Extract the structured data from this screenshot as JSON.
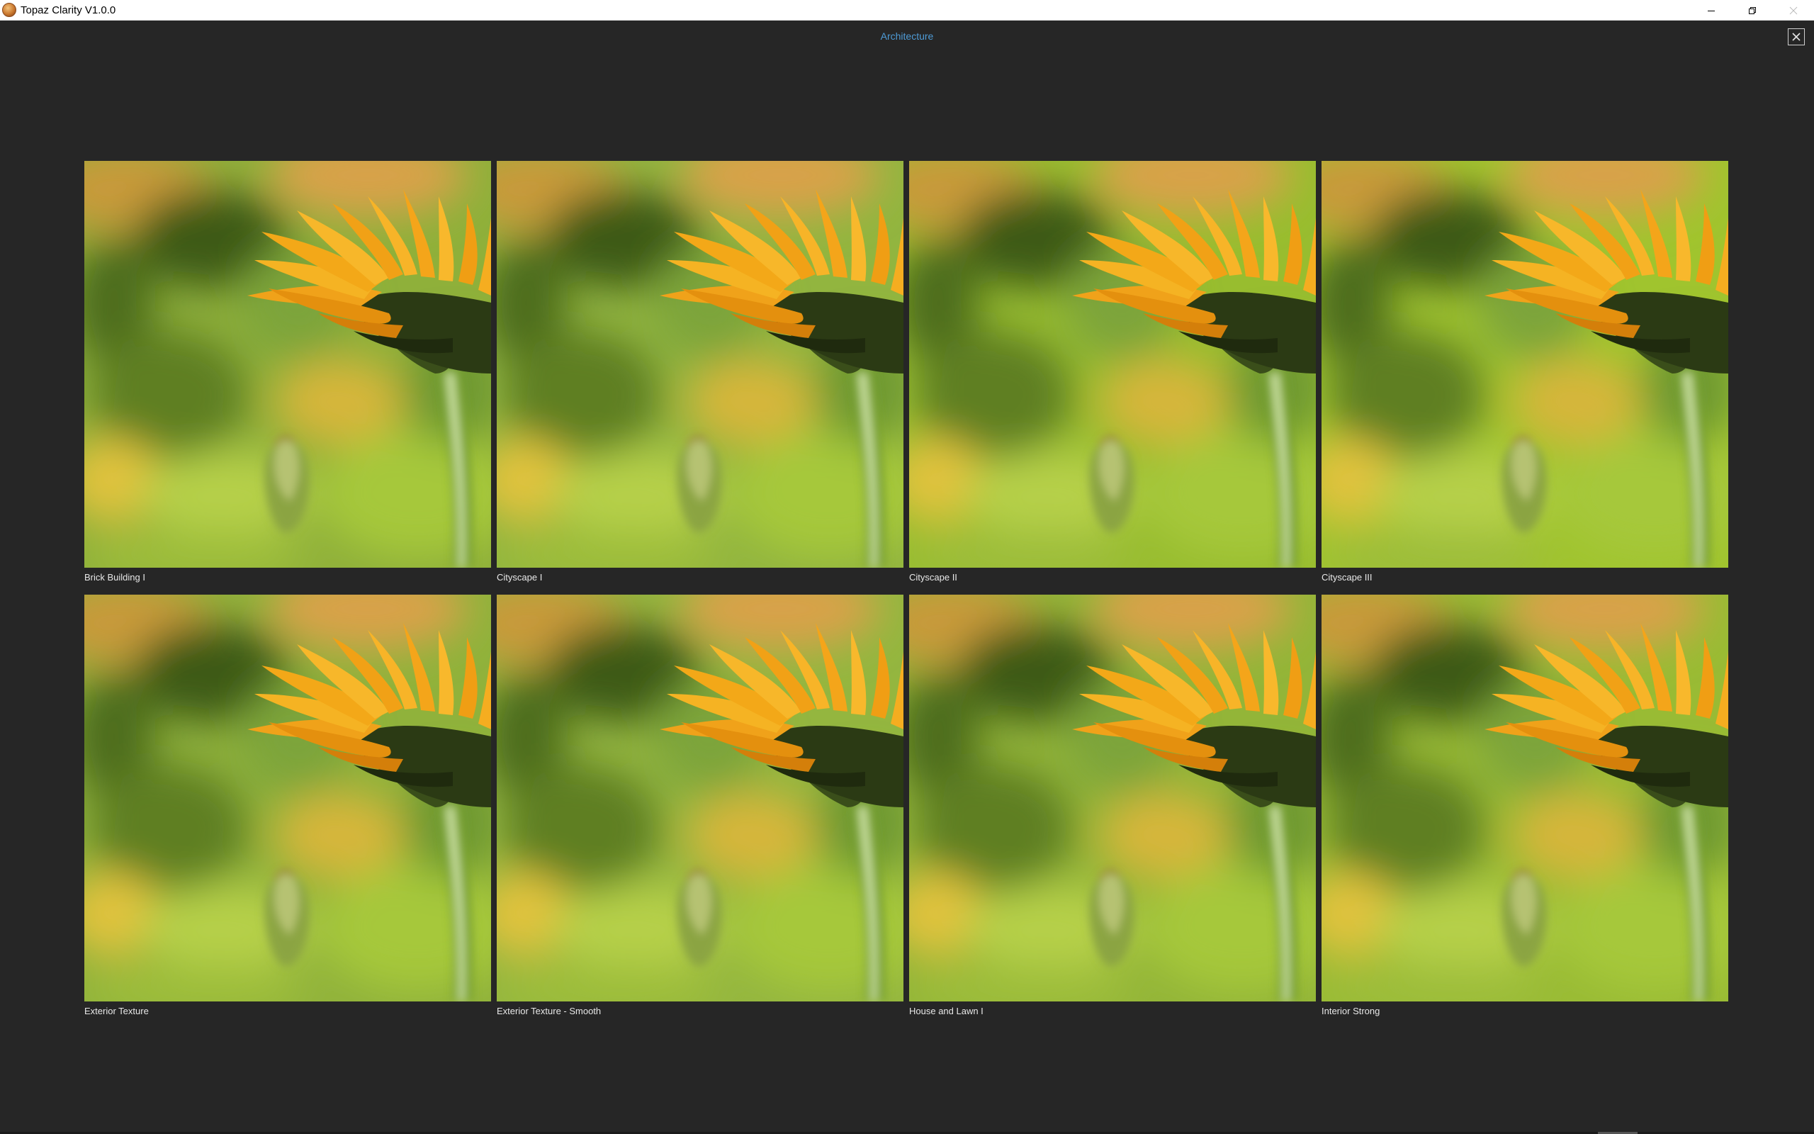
{
  "window": {
    "title": "Topaz Clarity V1.0.0",
    "icons": {
      "app": "topaz-logo-icon",
      "minimize": "minimize-icon",
      "restore": "restore-icon",
      "close": "close-icon"
    }
  },
  "header": {
    "category": "Architecture",
    "category_color": "#4e9bd6"
  },
  "presets": [
    {
      "label": "Brick Building I",
      "tone": "#8fb03a"
    },
    {
      "label": "Cityscape I",
      "tone": "#92b53f"
    },
    {
      "label": "Cityscape II",
      "tone": "#98bd2f"
    },
    {
      "label": "Cityscape III",
      "tone": "#a0c42e"
    },
    {
      "label": "Exterior Texture",
      "tone": "#90b23b"
    },
    {
      "label": "Exterior Texture - Smooth",
      "tone": "#94b63f"
    },
    {
      "label": "House and Lawn I",
      "tone": "#93b538"
    },
    {
      "label": "Interior Strong",
      "tone": "#99bb34"
    }
  ]
}
